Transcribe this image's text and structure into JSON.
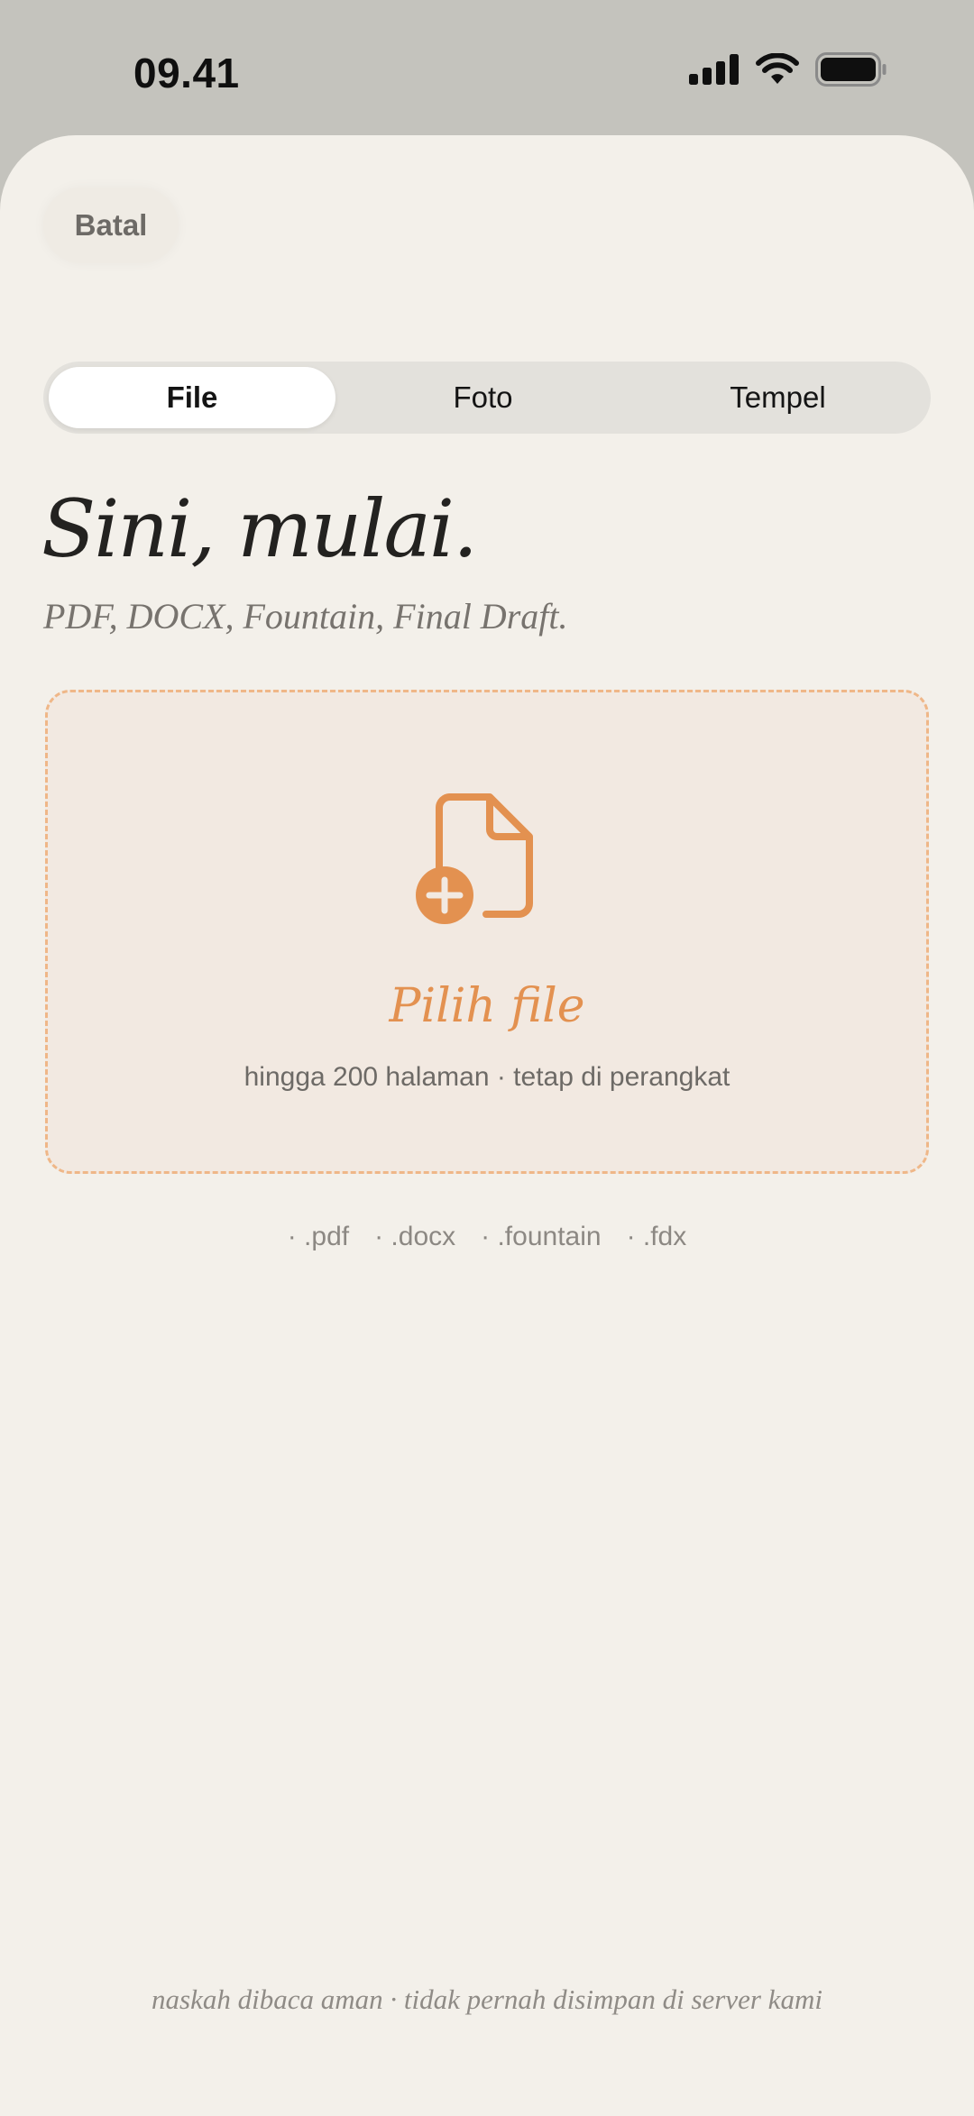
{
  "status_bar": {
    "time": "09.41",
    "icons": [
      "cellular-signal-icon",
      "wifi-icon",
      "battery-icon"
    ]
  },
  "header": {
    "cancel_label": "Batal"
  },
  "tabs": [
    {
      "label": "File",
      "active": true
    },
    {
      "label": "Foto",
      "active": false
    },
    {
      "label": "Tempel",
      "active": false
    }
  ],
  "main": {
    "title": "Sini, mulai.",
    "subtitle": "PDF, DOCX, Fountain, Final Draft.",
    "dropzone": {
      "icon": "add-document-icon",
      "label": "Pilih file",
      "hint": "hingga 200 halaman · tetap di perangkat"
    },
    "extensions": [
      "· .pdf",
      "· .docx",
      "· .fountain",
      "· .fdx"
    ]
  },
  "footer": {
    "note": "naskah dibaca aman · tidak pernah disimpan di server kami"
  },
  "colors": {
    "accent": "#e39150",
    "sheet_background": "#f3f0ea",
    "dropzone_border": "#efb788"
  }
}
